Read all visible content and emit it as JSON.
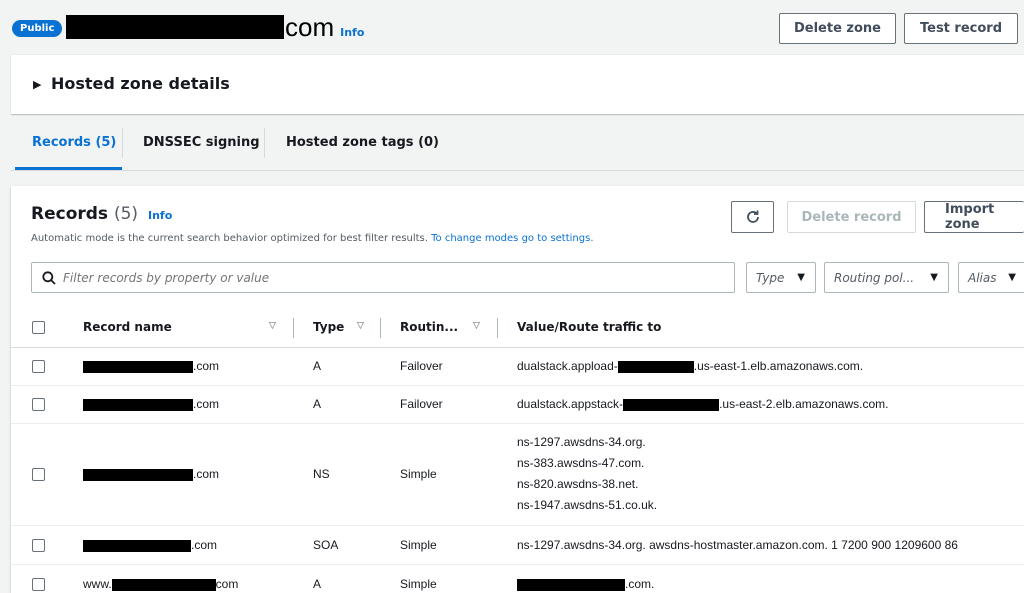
{
  "header": {
    "badge": "Public",
    "zone_name_suffix": "com",
    "info": "Info",
    "delete_zone": "Delete zone",
    "test_record": "Test record"
  },
  "details": {
    "label": "Hosted zone details"
  },
  "tabs": [
    {
      "label": "Records (5)",
      "active": true
    },
    {
      "label": "DNSSEC signing",
      "active": false
    },
    {
      "label": "Hosted zone tags (0)",
      "active": false
    }
  ],
  "records_panel": {
    "title": "Records",
    "count": "(5)",
    "info": "Info",
    "description": "Automatic mode is the current search behavior optimized for best filter results.",
    "description_link": "To change modes go to settings.",
    "refresh_icon": "refresh-icon",
    "delete_record": "Delete record",
    "import_zone": "Import zone",
    "search_placeholder": "Filter records by property or value",
    "filters": {
      "type": "Type",
      "routing": "Routing pol...",
      "alias": "Alias"
    },
    "columns": {
      "record_name": "Record name",
      "type": "Type",
      "routing": "Routin...",
      "value": "Value/Route traffic to"
    },
    "rows": [
      {
        "name_suffix": ".com",
        "type": "A",
        "routing": "Failover",
        "value_prefix": "dualstack.appload-",
        "value_suffix": ".us-east-1.elb.amazonaws.com."
      },
      {
        "name_suffix": ".com",
        "type": "A",
        "routing": "Failover",
        "value_prefix": "dualstack.appstack-",
        "value_suffix": ".us-east-2.elb.amazonaws.com."
      },
      {
        "name_suffix": ".com",
        "type": "NS",
        "routing": "Simple",
        "values": [
          "ns-1297.awsdns-34.org.",
          "ns-383.awsdns-47.com.",
          "ns-820.awsdns-38.net.",
          "ns-1947.awsdns-51.co.uk."
        ]
      },
      {
        "name_suffix": ".com",
        "type": "SOA",
        "routing": "Simple",
        "value": "ns-1297.awsdns-34.org. awsdns-hostmaster.amazon.com. 1 7200 900 1209600 86"
      },
      {
        "name_prefix": "www.",
        "name_suffix": "com",
        "type": "A",
        "routing": "Simple",
        "value_suffix": ".com."
      }
    ]
  }
}
